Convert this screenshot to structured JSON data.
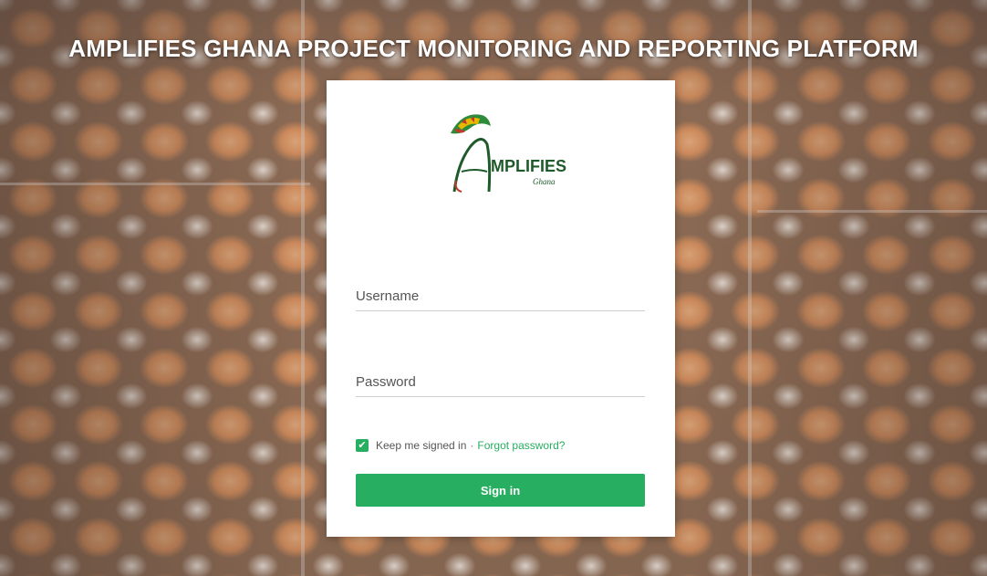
{
  "page": {
    "title": "AMPLIFIES GHANA PROJECT MONITORING AND REPORTING PLATFORM"
  },
  "logo": {
    "wordmark": "MPLIFIES",
    "sub": "Ghana",
    "icon": "amplifies-logo-icon"
  },
  "form": {
    "username_placeholder": "Username",
    "username_value": "",
    "password_placeholder": "Password",
    "password_value": "",
    "remember_label": "Keep me signed in",
    "remember_checked": true,
    "separator": "·",
    "forgot_label": "Forgot password?",
    "signin_label": "Sign in"
  },
  "colors": {
    "accent": "#27ae60",
    "title_text": "#ffffff",
    "card_bg": "#ffffff"
  }
}
